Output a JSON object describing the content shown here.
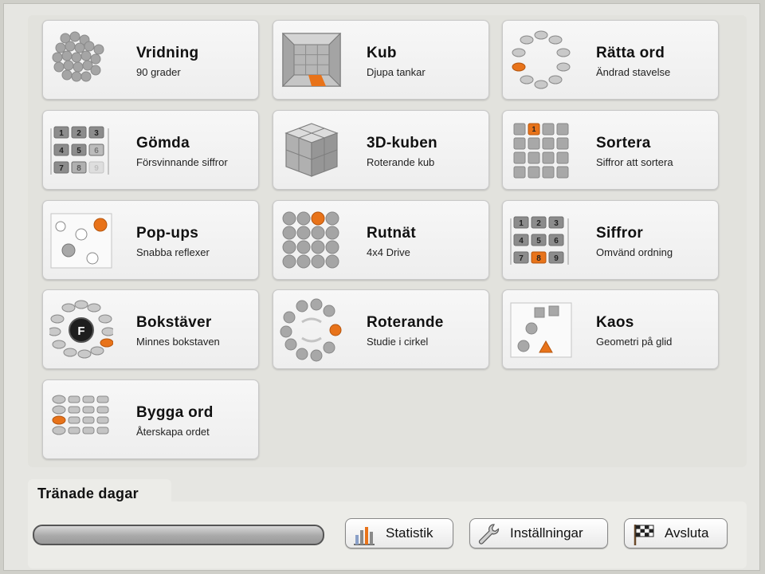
{
  "exercises": [
    {
      "title": "Vridning",
      "subtitle": "90 grader",
      "icon": "dot-cluster-icon"
    },
    {
      "title": "Kub",
      "subtitle": "Djupa tankar",
      "icon": "cube-room-icon"
    },
    {
      "title": "Rätta ord",
      "subtitle": "Ändrad stavelse",
      "icon": "word-ring-icon"
    },
    {
      "title": "Gömda",
      "subtitle": "Försvinnande siffror",
      "icon": "number-grid-icon"
    },
    {
      "title": "3D-kuben",
      "subtitle": "Roterande kub",
      "icon": "cube-3d-icon"
    },
    {
      "title": "Sortera",
      "subtitle": "Siffror att sortera",
      "icon": "sort-grid-icon"
    },
    {
      "title": "Pop-ups",
      "subtitle": "Snabba reflexer",
      "icon": "popup-circles-icon"
    },
    {
      "title": "Rutnät",
      "subtitle": "4x4 Drive",
      "icon": "circle-grid-icon"
    },
    {
      "title": "Siffror",
      "subtitle": "Omvänd ordning",
      "icon": "number-grid-reverse-icon"
    },
    {
      "title": "Bokstäver",
      "subtitle": "Minnes bokstaven",
      "icon": "letter-ring-icon"
    },
    {
      "title": "Roterande",
      "subtitle": "Studie i cirkel",
      "icon": "rotating-circle-icon"
    },
    {
      "title": "Kaos",
      "subtitle": "Geometri på glid",
      "icon": "shapes-icon"
    },
    {
      "title": "Bygga ord",
      "subtitle": "Återskapa ordet",
      "icon": "word-builder-icon"
    }
  ],
  "icon_text": {
    "digits": [
      "1",
      "2",
      "3",
      "4",
      "5",
      "6",
      "7",
      "8",
      "9"
    ],
    "sort_digit": "1",
    "letter": "F"
  },
  "colors": {
    "accent": "#e8731a",
    "dot": "#9a9a9a",
    "dot_light": "#c9c9c9"
  },
  "footer": {
    "section_label": "Tränade dagar",
    "progress": 0,
    "buttons": [
      {
        "label": "Statistik",
        "icon": "bar-chart-icon"
      },
      {
        "label": "Inställningar",
        "icon": "wrench-icon"
      },
      {
        "label": "Avsluta",
        "icon": "checkered-flag-icon"
      }
    ]
  }
}
